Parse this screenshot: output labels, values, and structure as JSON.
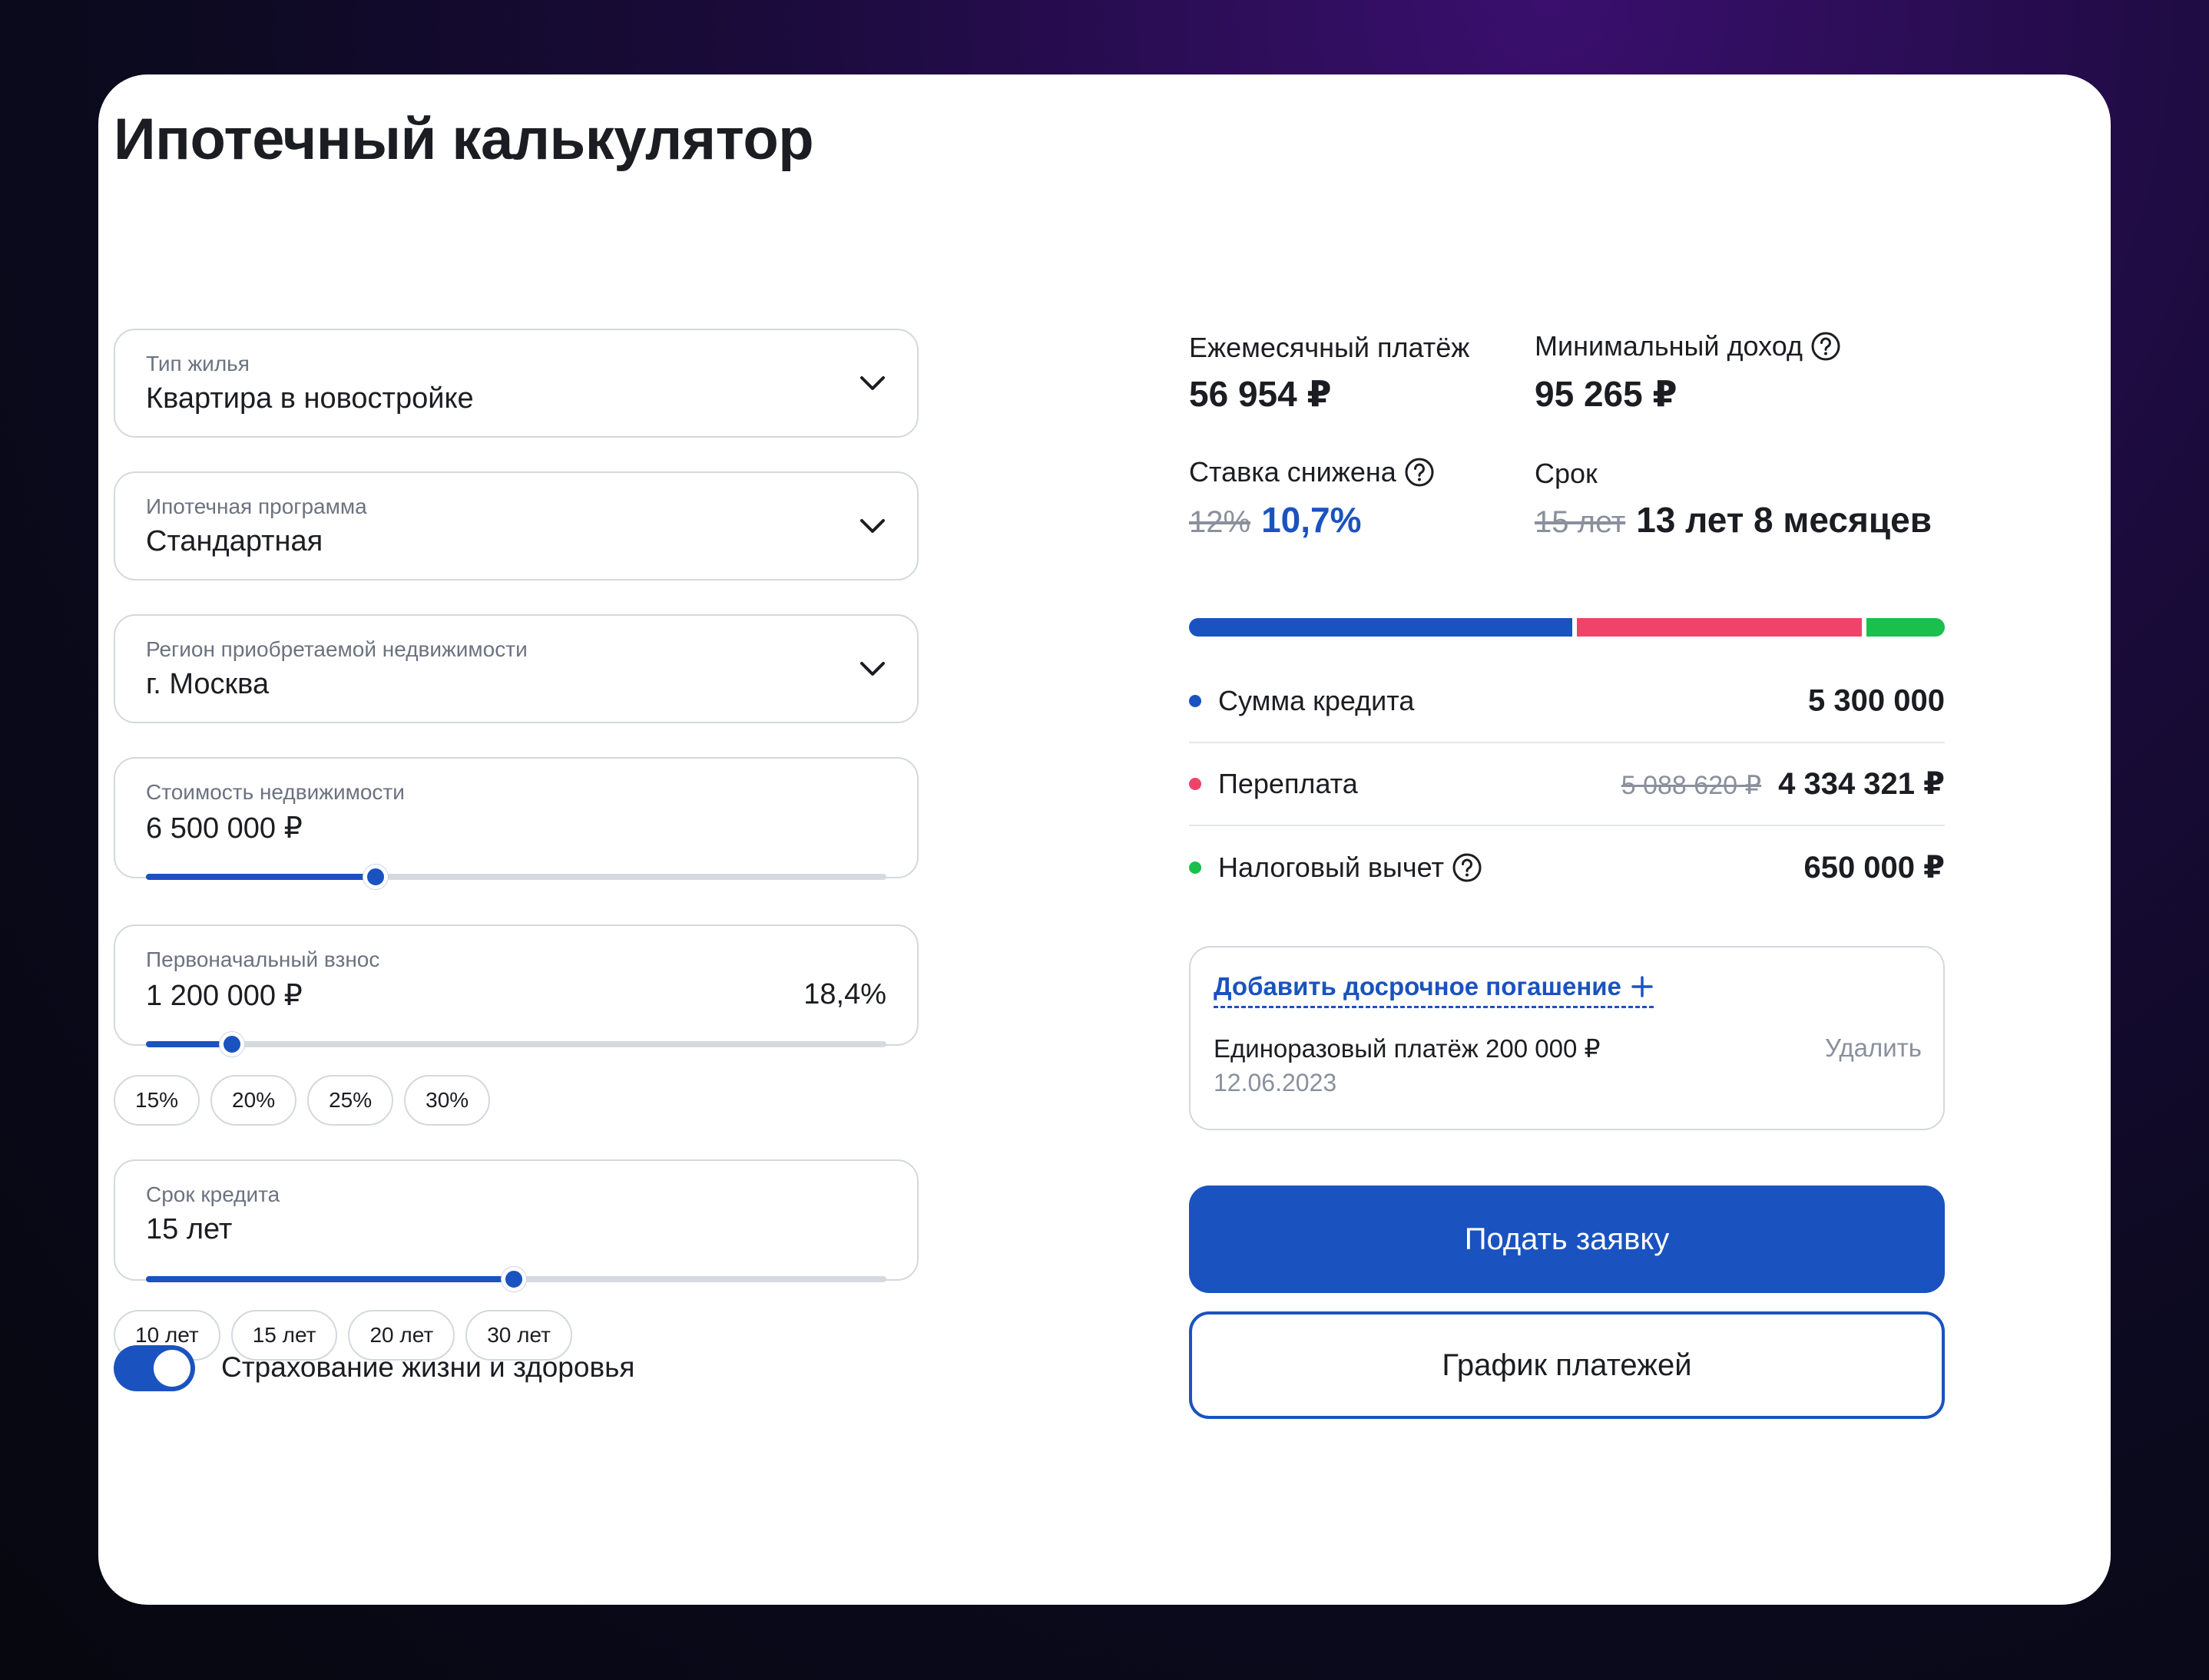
{
  "title": "Ипотечный калькулятор",
  "fields": {
    "housing_type": {
      "label": "Тип жилья",
      "value": "Квартира в новостройке"
    },
    "program": {
      "label": "Ипотечная программа",
      "value": "Стандартная"
    },
    "region": {
      "label": "Регион приобретаемой недвижимости",
      "value": "г. Москва"
    },
    "cost": {
      "label": "Стоимость недвижимости",
      "value": "6 500 000 ₽",
      "slider_fraction": 0.31
    },
    "down_payment": {
      "label": "Первоначальный взнос",
      "value": "1 200 000 ₽",
      "percent": "18,4%",
      "slider_fraction": 0.116
    },
    "term": {
      "label": "Срок кредита",
      "value": "15 лет",
      "slider_fraction": 0.497
    }
  },
  "down_payment_chips": [
    "15%",
    "20%",
    "25%",
    "30%"
  ],
  "term_chips": [
    "10 лет",
    "15 лет",
    "20 лет",
    "30 лет"
  ],
  "insurance": {
    "label": "Страхование жизни и здоровья",
    "enabled": true
  },
  "summary": {
    "monthly": {
      "label": "Ежемесячный платёж",
      "value": "56 954 ₽"
    },
    "min_income": {
      "label": "Минимальный доход",
      "value": "95 265 ₽"
    },
    "rate": {
      "label": "Ставка снижена",
      "old": "12%",
      "new": "10,7%"
    },
    "term": {
      "label": "Срок",
      "old": "15 лет",
      "new": "13 лет 8 месяцев"
    }
  },
  "breakdown": {
    "segments": [
      {
        "name": "Сумма кредита",
        "share": 0.513,
        "color": "#1a53c0"
      },
      {
        "name": "Переплата",
        "share": 0.382,
        "color": "#f0436a"
      },
      {
        "name": "Налоговый вычет",
        "share": 0.105,
        "color": "#1bbf4c"
      }
    ],
    "loan": {
      "label": "Сумма кредита",
      "value": "5 300 000"
    },
    "overpay": {
      "label": "Переплата",
      "old": "5 088 620 ₽",
      "value": "4 334 321 ₽"
    },
    "tax": {
      "label": "Налоговый вычет",
      "value": "650 000 ₽"
    }
  },
  "early_repayment": {
    "add_label": "Добавить досрочное погашение",
    "item_label": "Единоразовый платёж 200 000 ₽",
    "item_date": "12.06.2023",
    "delete_label": "Удалить"
  },
  "buttons": {
    "apply": "Подать заявку",
    "schedule": "График платежей"
  }
}
